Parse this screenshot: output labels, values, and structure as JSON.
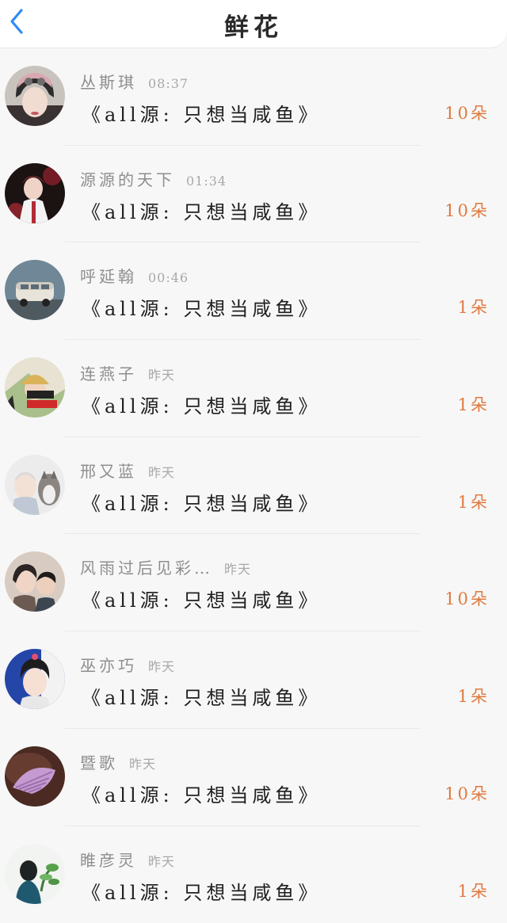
{
  "header": {
    "title": "鲜花",
    "back_icon": "chevron-left-icon",
    "accent": "#2f8cf4"
  },
  "colors": {
    "count": "#e07a3f",
    "name": "#8e8e8e"
  },
  "items": [
    {
      "name": "丛斯琪",
      "time": "08:37",
      "book": "《all源:  只想当咸鱼》",
      "count": "10朵",
      "avatar": "girl-helmet-avatar"
    },
    {
      "name": "源源的天下",
      "time": "01:34",
      "book": "《all源:  只想当咸鱼》",
      "count": "10朵",
      "avatar": "singer-stage-avatar"
    },
    {
      "name": "呼延翰",
      "time": "00:46",
      "book": "《all源:  只想当咸鱼》",
      "count": "1朵",
      "avatar": "toy-van-avatar"
    },
    {
      "name": "连燕子",
      "time": "昨天",
      "book": "《all源:  只想当咸鱼》",
      "count": "1朵",
      "avatar": "child-hat-avatar"
    },
    {
      "name": "邢又蓝",
      "time": "昨天",
      "book": "《all源:  只想当咸鱼》",
      "count": "1朵",
      "avatar": "baby-dog-avatar"
    },
    {
      "name": "风雨过后见彩…",
      "time": "昨天",
      "book": "《all源:  只想当咸鱼》",
      "count": "10朵",
      "avatar": "mother-child-avatar"
    },
    {
      "name": "巫亦巧",
      "time": "昨天",
      "book": "《all源:  只想当咸鱼》",
      "count": "1朵",
      "avatar": "boy-portrait-avatar"
    },
    {
      "name": "暨歌",
      "time": "昨天",
      "book": "《all源:  只想当咸鱼》",
      "count": "10朵",
      "avatar": "seashell-avatar"
    },
    {
      "name": "睢彦灵",
      "time": "昨天",
      "book": "《all源:  只想当咸鱼》",
      "count": "1朵",
      "avatar": "girl-plant-avatar"
    }
  ]
}
